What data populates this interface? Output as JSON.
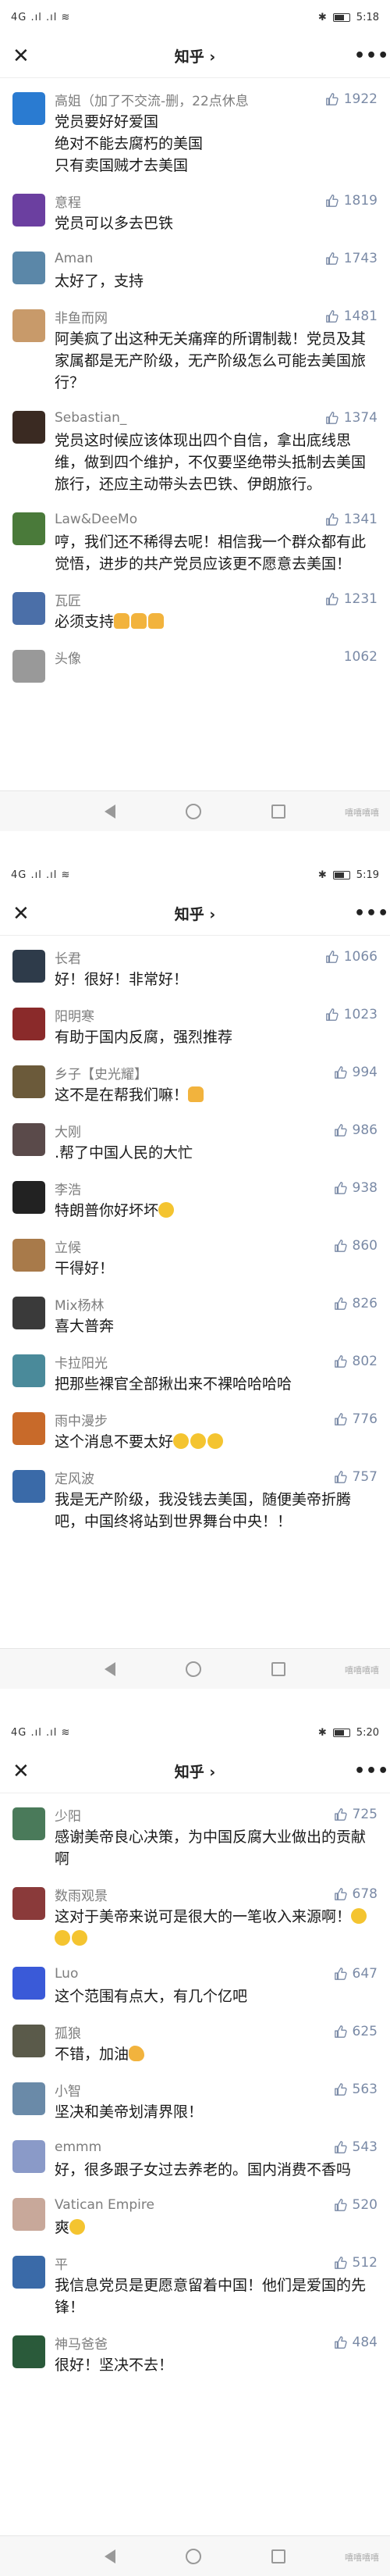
{
  "screens": [
    {
      "time": "5:18",
      "nav_title": "知乎",
      "comments": [
        {
          "name": "高姐（加了不交流-删，22点休息",
          "likes": "1922",
          "text": "党员要好好爱国\n绝对不能去腐朽的美国\n只有卖国贼才去美国",
          "avatar_color": "#2a7bd1"
        },
        {
          "name": "意程",
          "likes": "1819",
          "text": "党员可以多去巴铁",
          "avatar_color": "#6b3fa0"
        },
        {
          "name": "Aman",
          "likes": "1743",
          "text": "太好了，支持",
          "avatar_color": "#5b87a8"
        },
        {
          "name": "非鱼而网",
          "likes": "1481",
          "text": "阿美疯了出这种无关痛痒的所谓制裁！党员及其家属都是无产阶级，无产阶级怎么可能去美国旅行？",
          "avatar_color": "#c89a6a"
        },
        {
          "name": "Sebastian_",
          "likes": "1374",
          "text": "党员这时候应该体现出四个自信，拿出底线思维，做到四个维护，不仅要坚绝带头抵制去美国旅行，还应主动带头去巴铁、伊朗旅行。",
          "avatar_color": "#3a2a22"
        },
        {
          "name": "Law&DeeMo",
          "likes": "1341",
          "text": "哼，我们还不稀得去呢！相信我一个群众都有此觉悟，进步的共产党员应该更不愿意去美国！",
          "avatar_color": "#4a7a3a"
        },
        {
          "name": "瓦匠",
          "likes": "1231",
          "text": "必须支持",
          "emojis": [
            "thumbs",
            "thumbs",
            "thumbs"
          ],
          "avatar_color": "#4b6fa8"
        }
      ],
      "partial_name": "头像",
      "partial_likes": "1062"
    },
    {
      "time": "5:19",
      "nav_title": "知乎",
      "comments": [
        {
          "name": "长君",
          "likes": "1066",
          "text": "好！很好！非常好！",
          "avatar_color": "#2e3b4a"
        },
        {
          "name": "阳明寒",
          "likes": "1023",
          "text": "有助于国内反腐，强烈推荐",
          "avatar_color": "#8a2a2a"
        },
        {
          "name": "乡子【史光耀】",
          "likes": "994",
          "text": "这不是在帮我们嘛！",
          "emojis": [
            "thumbs"
          ],
          "avatar_color": "#6b5a3a"
        },
        {
          "name": "大刚",
          "likes": "986",
          "text": ".帮了中国人民的大忙",
          "avatar_color": "#5a4a4a"
        },
        {
          "name": "李浩",
          "likes": "938",
          "text": "特朗普你好坏坏",
          "emojis": [
            "face"
          ],
          "avatar_color": "#222222"
        },
        {
          "name": "立候",
          "likes": "860",
          "text": "干得好！",
          "avatar_color": "#a87a4a"
        },
        {
          "name": "Mix杨林",
          "likes": "826",
          "text": "喜大普奔",
          "avatar_color": "#3a3a3a"
        },
        {
          "name": "卡拉阳光",
          "likes": "802",
          "text": "把那些裸官全部揪出来不裸哈哈哈哈",
          "avatar_color": "#4a8a9a"
        },
        {
          "name": "雨中漫步",
          "likes": "776",
          "text": "这个消息不要太好",
          "emojis": [
            "face",
            "face",
            "face"
          ],
          "avatar_color": "#c86a2a"
        },
        {
          "name": "定风波",
          "likes": "757",
          "text": "我是无产阶级，我没钱去美国，随便美帝折腾吧，中国终将站到世界舞台中央！！",
          "avatar_color": "#3a6aa8"
        }
      ]
    },
    {
      "time": "5:20",
      "nav_title": "知乎",
      "comments": [
        {
          "name": "少阳",
          "likes": "725",
          "text": "感谢美帝良心决策，为中国反腐大业做出的贡献啊",
          "avatar_color": "#4a7a5a"
        },
        {
          "name": "数雨观景",
          "likes": "678",
          "text": "这对于美帝来说可是很大的一笔收入来源啊！",
          "emojis": [
            "face",
            "face",
            "face"
          ],
          "avatar_color": "#8a3a3a"
        },
        {
          "name": "Luo",
          "likes": "647",
          "text": "这个范围有点大，有几个亿吧",
          "avatar_color": "#3a5ad8"
        },
        {
          "name": "孤狼",
          "likes": "625",
          "text": "不错，加油",
          "emojis": [
            "flex"
          ],
          "avatar_color": "#5a5a4a"
        },
        {
          "name": "小智",
          "likes": "563",
          "text": "坚决和美帝划清界限！",
          "avatar_color": "#6a8aa8"
        },
        {
          "name": "emmm",
          "likes": "543",
          "text": "好，很多跟子女过去养老的。国内消费不香吗",
          "avatar_color": "#8a9ac8"
        },
        {
          "name": "Vatican Empire",
          "likes": "520",
          "text": "爽",
          "emojis": [
            "face"
          ],
          "avatar_color": "#c8a89a"
        },
        {
          "name": "平",
          "likes": "512",
          "text": "我信息党员是更愿意留着中国！他们是爱国的先锋！",
          "avatar_color": "#3a6aa8"
        },
        {
          "name": "神马爸爸",
          "likes": "484",
          "text": "很好！坚决不去！",
          "avatar_color": "#2a5a3a"
        }
      ]
    }
  ],
  "status": {
    "signal": "4G .ıl .ıl",
    "wifi": "≋"
  },
  "watermark": "嘻嘻嘻嘻",
  "more_label": "•••",
  "close_label": "✕",
  "nav_chevron": "›"
}
